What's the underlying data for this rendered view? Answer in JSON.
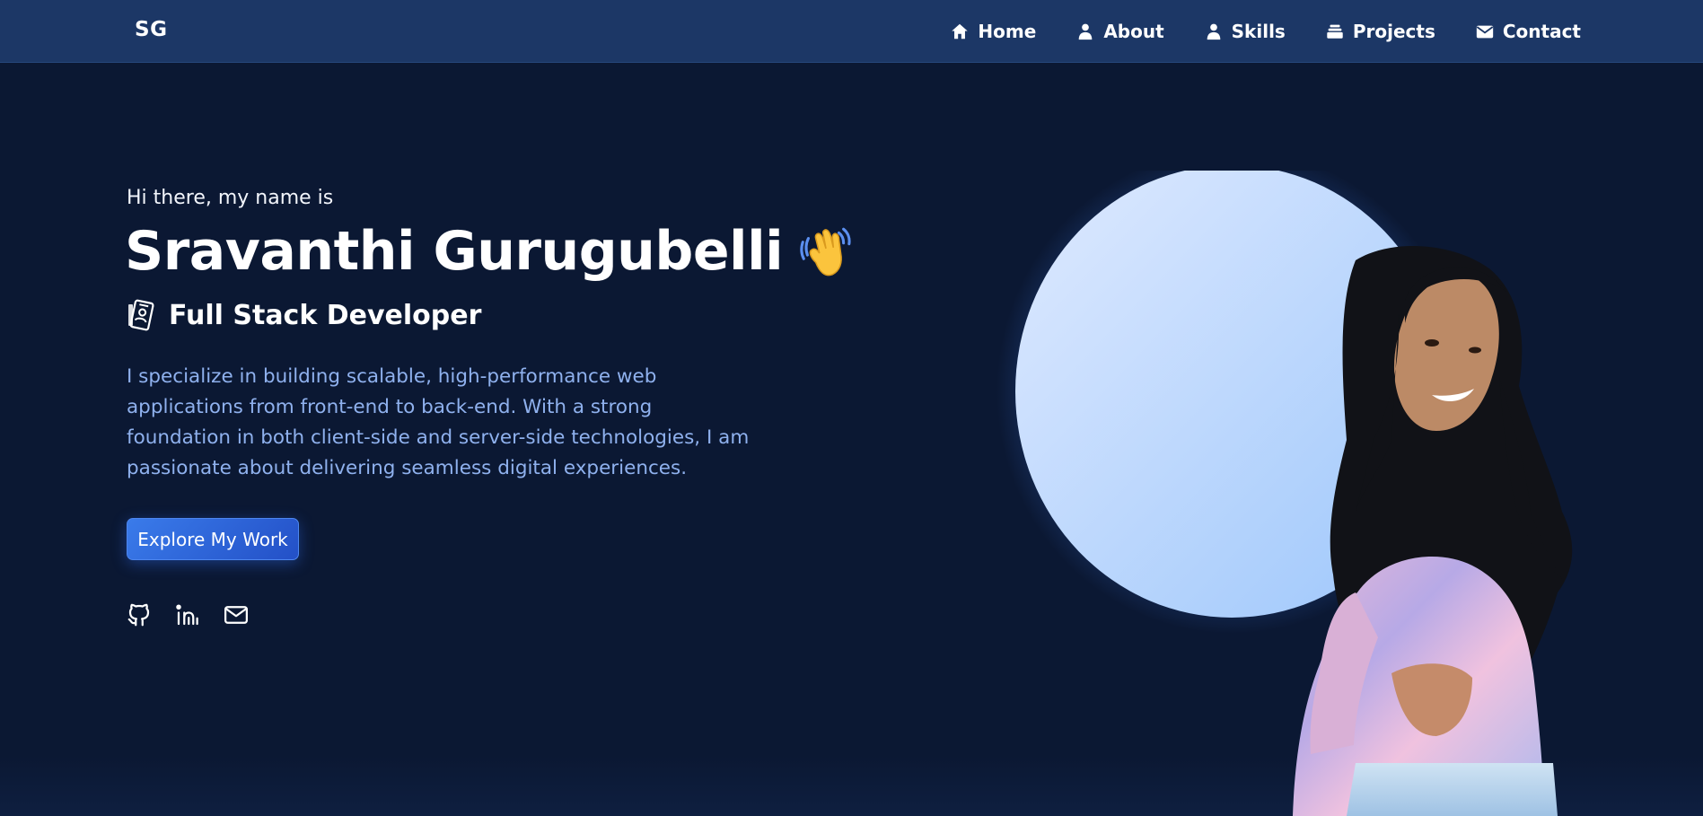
{
  "navbar": {
    "brand": "SG",
    "items": [
      {
        "label": "Home",
        "icon": "home-icon"
      },
      {
        "label": "About",
        "icon": "user-icon"
      },
      {
        "label": "Skills",
        "icon": "user-icon"
      },
      {
        "label": "Projects",
        "icon": "layers-icon"
      },
      {
        "label": "Contact",
        "icon": "envelope-icon"
      }
    ]
  },
  "hero": {
    "greeting": "Hi there, my name is",
    "name": "Sravanthi Gurugubelli",
    "name_emoji": "waving-hand-icon",
    "role_icon": "id-card-icon",
    "role": "Full Stack Developer",
    "description": "I specialize in building scalable, high-performance web applications from front-end to back-end. With a strong foundation in both client-side and server-side technologies, I am passionate about delivering seamless digital experiences.",
    "cta_label": "Explore My Work",
    "socials": [
      "github-icon",
      "linkedin-icon",
      "mail-icon"
    ]
  },
  "colors": {
    "navbar_bg": "#1c3766",
    "page_bg": "#0b1833",
    "accent_text": "#8fb1ee",
    "button": "#2f67e0",
    "circle": "#bcd8ff"
  }
}
